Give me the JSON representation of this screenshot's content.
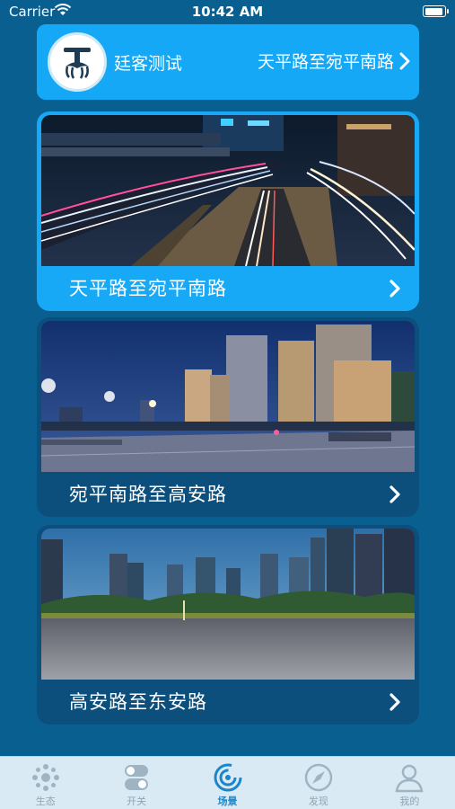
{
  "status_bar": {
    "carrier": "Carrier",
    "time": "10:42 AM"
  },
  "header": {
    "user_name": "廷客测试",
    "route": "天平路至宛平南路"
  },
  "scenes": [
    {
      "label": "天平路至宛平南路"
    },
    {
      "label": "宛平南路至高安路"
    },
    {
      "label": "高安路至东安路"
    }
  ],
  "tabs": [
    {
      "label": "生态",
      "icon": "ecology-icon"
    },
    {
      "label": "开关",
      "icon": "switch-icon"
    },
    {
      "label": "场景",
      "icon": "scene-icon",
      "active": true
    },
    {
      "label": "发现",
      "icon": "compass-icon"
    },
    {
      "label": "我的",
      "icon": "user-icon"
    }
  ],
  "colors": {
    "background": "#0a5f91",
    "accent": "#14a8f6",
    "card_dark": "#0d4f7c",
    "tab_active": "#1b86c9"
  }
}
